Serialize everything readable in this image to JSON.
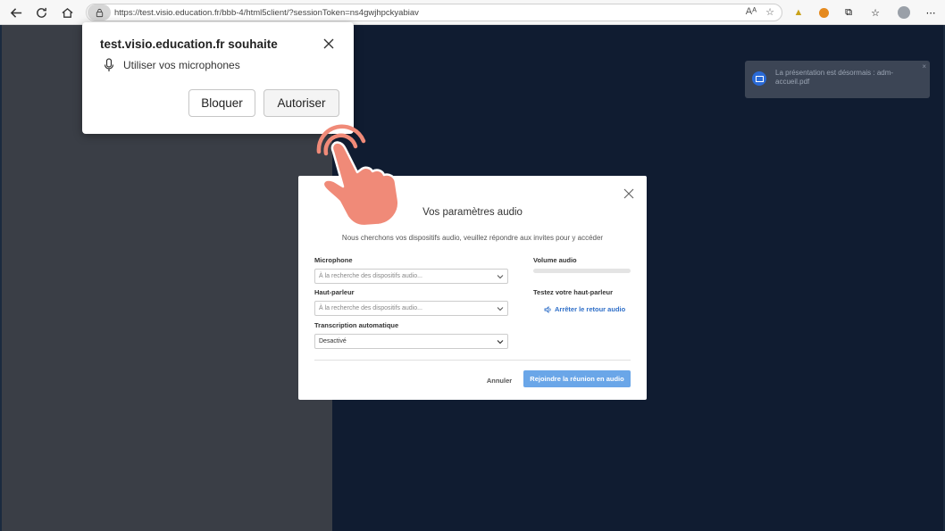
{
  "browser": {
    "url": "https://test.visio.education.fr/bbb-4/html5client/?sessionToken=ns4gwjhpckyabiav",
    "read_aloud_label": "Aᴬ"
  },
  "toast": {
    "text": "La présentation est désormais : adm-accueil.pdf"
  },
  "permission": {
    "title": "test.visio.education.fr souhaite",
    "request": "Utiliser vos microphones",
    "block_label": "Bloquer",
    "allow_label": "Autoriser"
  },
  "audio_modal": {
    "title": "Vos paramètres audio",
    "subtitle": "Nous cherchons vos dispositifs audio, veuillez répondre aux invites pour y accéder",
    "microphone_label": "Microphone",
    "microphone_value": "À la recherche des dispositifs audio...",
    "speaker_label": "Haut-parleur",
    "speaker_value": "À la recherche des dispositifs audio...",
    "transcription_label": "Transcription automatique",
    "transcription_value": "Desactivé",
    "volume_label": "Volume audio",
    "volume_level": 0,
    "test_speaker_label": "Testez votre haut-parleur",
    "stop_audio_label": "Arrêter le retour audio",
    "cancel_label": "Annuler",
    "join_label": "Rejoindre la réunion en audio"
  },
  "colors": {
    "join_button": "#6aa6e8",
    "link": "#2f6fc8",
    "hand": "#f08a78"
  }
}
